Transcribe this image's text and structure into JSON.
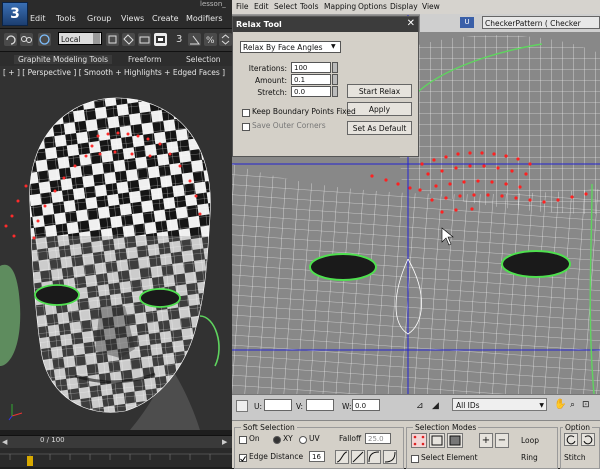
{
  "app": {
    "logo_letter": "3",
    "file_title": "lesson_",
    "menu": [
      "Edit",
      "Tools",
      "Group",
      "Views",
      "Create",
      "Modifiers"
    ],
    "toolbar": {
      "reference_coord_system": "Local",
      "snap_value": "3"
    },
    "graphite_tabs": [
      "Graphite Modeling Tools",
      "Freeform",
      "Selection"
    ],
    "viewport_label": "[ + ] [ Perspective ] [ Smooth + Highlights + Edged Faces ]",
    "time_slider": "0 / 100",
    "accent_color": "#3a6fb4"
  },
  "uv_editor": {
    "menu": [
      "File",
      "Edit",
      "Select",
      "Tools",
      "Mapping",
      "Options",
      "Display",
      "View"
    ],
    "texture_dropdown": "CheckerPattern  ( Checker",
    "bottom": {
      "u_label": "U:",
      "v_label": "V:",
      "w_label": "W:",
      "w_value": "0.0",
      "id_filter": "All IDs"
    },
    "soft_selection": {
      "title": "Soft Selection",
      "on_label": "On",
      "xy_label": "XY",
      "uv_label": "UV",
      "falloff_label": "Falloff",
      "falloff_value": "25.0",
      "edge_distance_label": "Edge Distance",
      "edge_distance_value": "16"
    },
    "selection_modes": {
      "title": "Selection Modes",
      "select_element_label": "Select Element",
      "loop_label": "Loop",
      "ring_label": "Ring"
    },
    "rotate": {
      "stitch_label": "Stitch",
      "option_label": "Option"
    }
  },
  "relax_dialog": {
    "title": "Relax Tool",
    "close": "✕",
    "method": "Relax By Face Angles",
    "iterations_label": "Iterations:",
    "iterations_value": "100",
    "amount_label": "Amount:",
    "amount_value": "0.1",
    "stretch_label": "Stretch:",
    "stretch_value": "0.0",
    "keep_boundary_label": "Keep Boundary Points Fixed",
    "save_outer_label": "Save Outer Corners",
    "start_relax_label": "Start Relax",
    "apply_label": "Apply",
    "save_default_label": "Set As Default"
  }
}
